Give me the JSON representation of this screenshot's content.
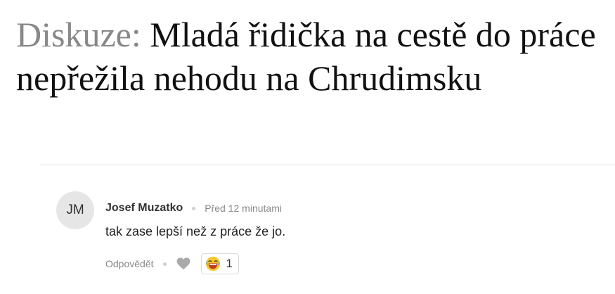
{
  "article": {
    "title_prefix": "Diskuze:",
    "title": "Mladá řidička na cestě do práce nepřežila nehodu na Chrudimsku"
  },
  "comment": {
    "avatar_initials": "JM",
    "author": "Josef Muzatko",
    "timestamp": "Před 12 minutami",
    "text": "tak zase lepší než z práce že jo.",
    "reply_label": "Odpovědět",
    "like_icon": "heart-icon",
    "reaction": {
      "icon": "laughing-emoji-icon",
      "count": "1"
    }
  },
  "colors": {
    "title_prefix": "#888888",
    "heart": "#aaaaaa",
    "emoji_face": "#f4c82d",
    "emoji_mouth": "#c0392b"
  }
}
